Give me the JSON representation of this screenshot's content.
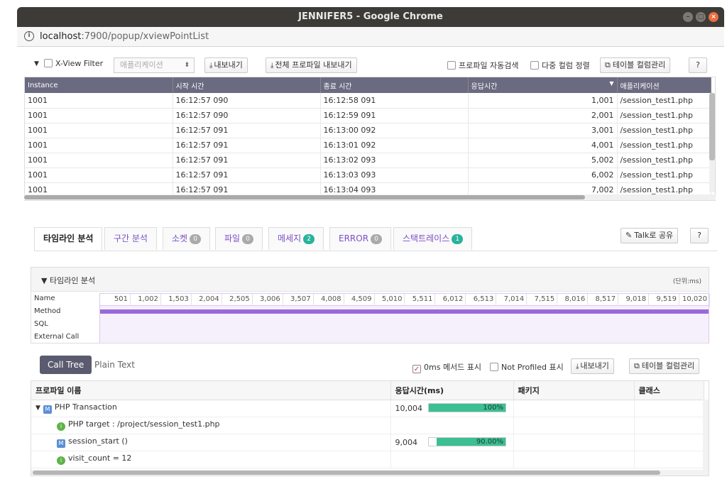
{
  "window": {
    "title": "JENNIFER5 - Google Chrome",
    "url_host": "localhost",
    "url_path": ":7900/popup/xviewPointList"
  },
  "toolbar": {
    "filter_label": "X-View Filter",
    "app_select_placeholder": "애플리케이션",
    "export_label": "내보내기",
    "export_all_label": "전체 프로파일 내보내기",
    "profile_autosearch_label": "프로파일 자동검색",
    "multi_sort_label": "다중 컬럼 정렬",
    "table_column_manage_label": "테이블 컬럼관리"
  },
  "grid": {
    "columns": [
      "Instance",
      "시작 시간",
      "종료 시간",
      "응답시간",
      "애플리케이션"
    ],
    "sort_indicator": "▼",
    "rows": [
      [
        "1001",
        "16:12:57 090",
        "16:12:58 091",
        "1,001",
        "/session_test1.php"
      ],
      [
        "1001",
        "16:12:57 090",
        "16:12:59 091",
        "2,001",
        "/session_test1.php"
      ],
      [
        "1001",
        "16:12:57 091",
        "16:13:00 092",
        "3,001",
        "/session_test1.php"
      ],
      [
        "1001",
        "16:12:57 091",
        "16:13:01 092",
        "4,001",
        "/session_test1.php"
      ],
      [
        "1001",
        "16:12:57 091",
        "16:13:02 093",
        "5,002",
        "/session_test1.php"
      ],
      [
        "1001",
        "16:12:57 091",
        "16:13:03 093",
        "6,002",
        "/session_test1.php"
      ],
      [
        "1001",
        "16:12:57 091",
        "16:13:04 093",
        "7,002",
        "/session_test1.php"
      ]
    ]
  },
  "tabs": [
    {
      "label": "타임라인 분석",
      "badge": "",
      "badge_color": "",
      "active": true
    },
    {
      "label": "구간 분석",
      "badge": "",
      "badge_color": "",
      "active": false
    },
    {
      "label": "소켓",
      "badge": "0",
      "badge_color": "gray",
      "active": false
    },
    {
      "label": "파일",
      "badge": "0",
      "badge_color": "gray",
      "active": false
    },
    {
      "label": "메세지",
      "badge": "2",
      "badge_color": "teal",
      "active": false
    },
    {
      "label": "ERROR",
      "badge": "0",
      "badge_color": "gray",
      "active": false
    },
    {
      "label": "스택트레이스",
      "badge": "1",
      "badge_color": "teal",
      "active": false
    }
  ],
  "talk_share_label": "Talk로 공유",
  "timeline": {
    "title": "▼ 타임라인 분석",
    "unit": "(단위:ms)",
    "row_labels": [
      "Name",
      "Method",
      "SQL",
      "External Call"
    ],
    "ticks": [
      "501",
      "1,002",
      "1,503",
      "2,004",
      "2,505",
      "3,006",
      "3,507",
      "4,008",
      "4,509",
      "5,010",
      "5,511",
      "6,012",
      "6,513",
      "7,014",
      "7,515",
      "8,016",
      "8,517",
      "9,018",
      "9,519",
      "10,020"
    ]
  },
  "calltree": {
    "tab_call_tree": "Call Tree",
    "tab_plain_text": "Plain Text",
    "show_0ms_label": "0ms 메서드 표시",
    "not_profiled_label": "Not Profiled 표시",
    "export_label": "내보내기",
    "table_column_manage_label": "테이블 컬럼관리",
    "columns": [
      "프로파일 이름",
      "응답시간(ms)",
      "패키지",
      "클래스"
    ],
    "rows": [
      {
        "name": "PHP Transaction",
        "type": "m",
        "indent": 0,
        "expander": "▼",
        "time": "10,004",
        "percent": 100,
        "percent_label": "100%"
      },
      {
        "name": "PHP target : /project/session_test1.php",
        "type": "i",
        "indent": 1,
        "expander": "",
        "time": "",
        "percent": null,
        "percent_label": ""
      },
      {
        "name": "session_start ()",
        "type": "m",
        "indent": 1,
        "expander": "",
        "time": "9,004",
        "percent": 90,
        "percent_label": "90.00%"
      },
      {
        "name": "visit_count = 12",
        "type": "i",
        "indent": 1,
        "expander": "",
        "time": "",
        "percent": null,
        "percent_label": ""
      }
    ]
  }
}
